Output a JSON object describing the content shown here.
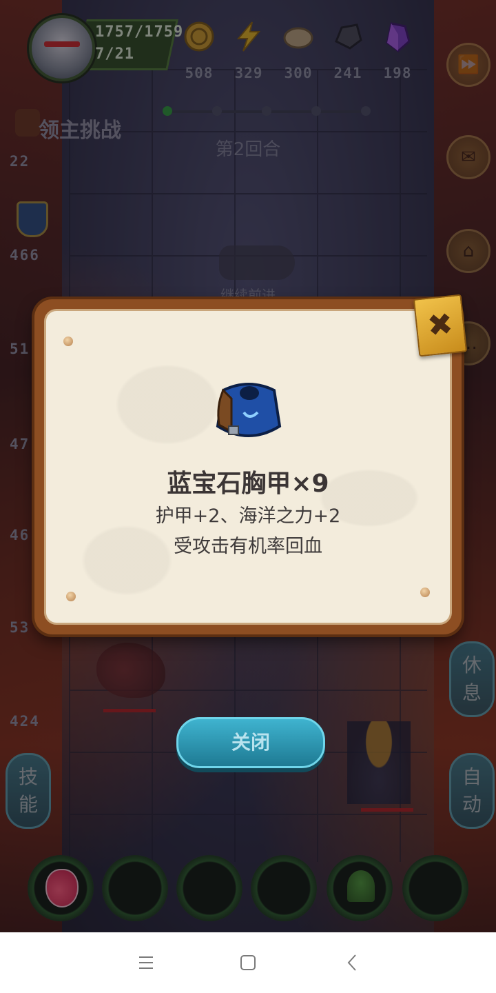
{
  "hud": {
    "hp": "1757/1759",
    "level": "7/21",
    "resources": [
      {
        "icon": "gold-coin-icon",
        "value": "508"
      },
      {
        "icon": "lightning-icon",
        "value": "329"
      },
      {
        "icon": "stone-icon",
        "value": "300"
      },
      {
        "icon": "iron-ore-icon",
        "value": "241"
      },
      {
        "icon": "purple-crystal-icon",
        "value": "198"
      }
    ]
  },
  "stage": {
    "title": "领主挑战",
    "round": "第2回合",
    "continue_hint": "继续前进"
  },
  "stats": {
    "attack": "22",
    "defense": "466",
    "stat3": "51",
    "stat4": "47",
    "stat5": "46",
    "stat6": "53",
    "stat7": "424"
  },
  "side_buttons": {
    "rest": "休\n息",
    "skills": "技\n能",
    "auto": "自\n动"
  },
  "modal": {
    "item_name": "蓝宝石胸甲×9",
    "desc_line1": "护甲+2、海洋之力+2",
    "desc_line2": "受攻击有机率回血",
    "close_x": "✖"
  },
  "close_button": {
    "label": "关闭"
  },
  "colors": {
    "accent": "#3fb3cf",
    "parchment": "#f3ecdc",
    "frame": "#8d4e22"
  }
}
